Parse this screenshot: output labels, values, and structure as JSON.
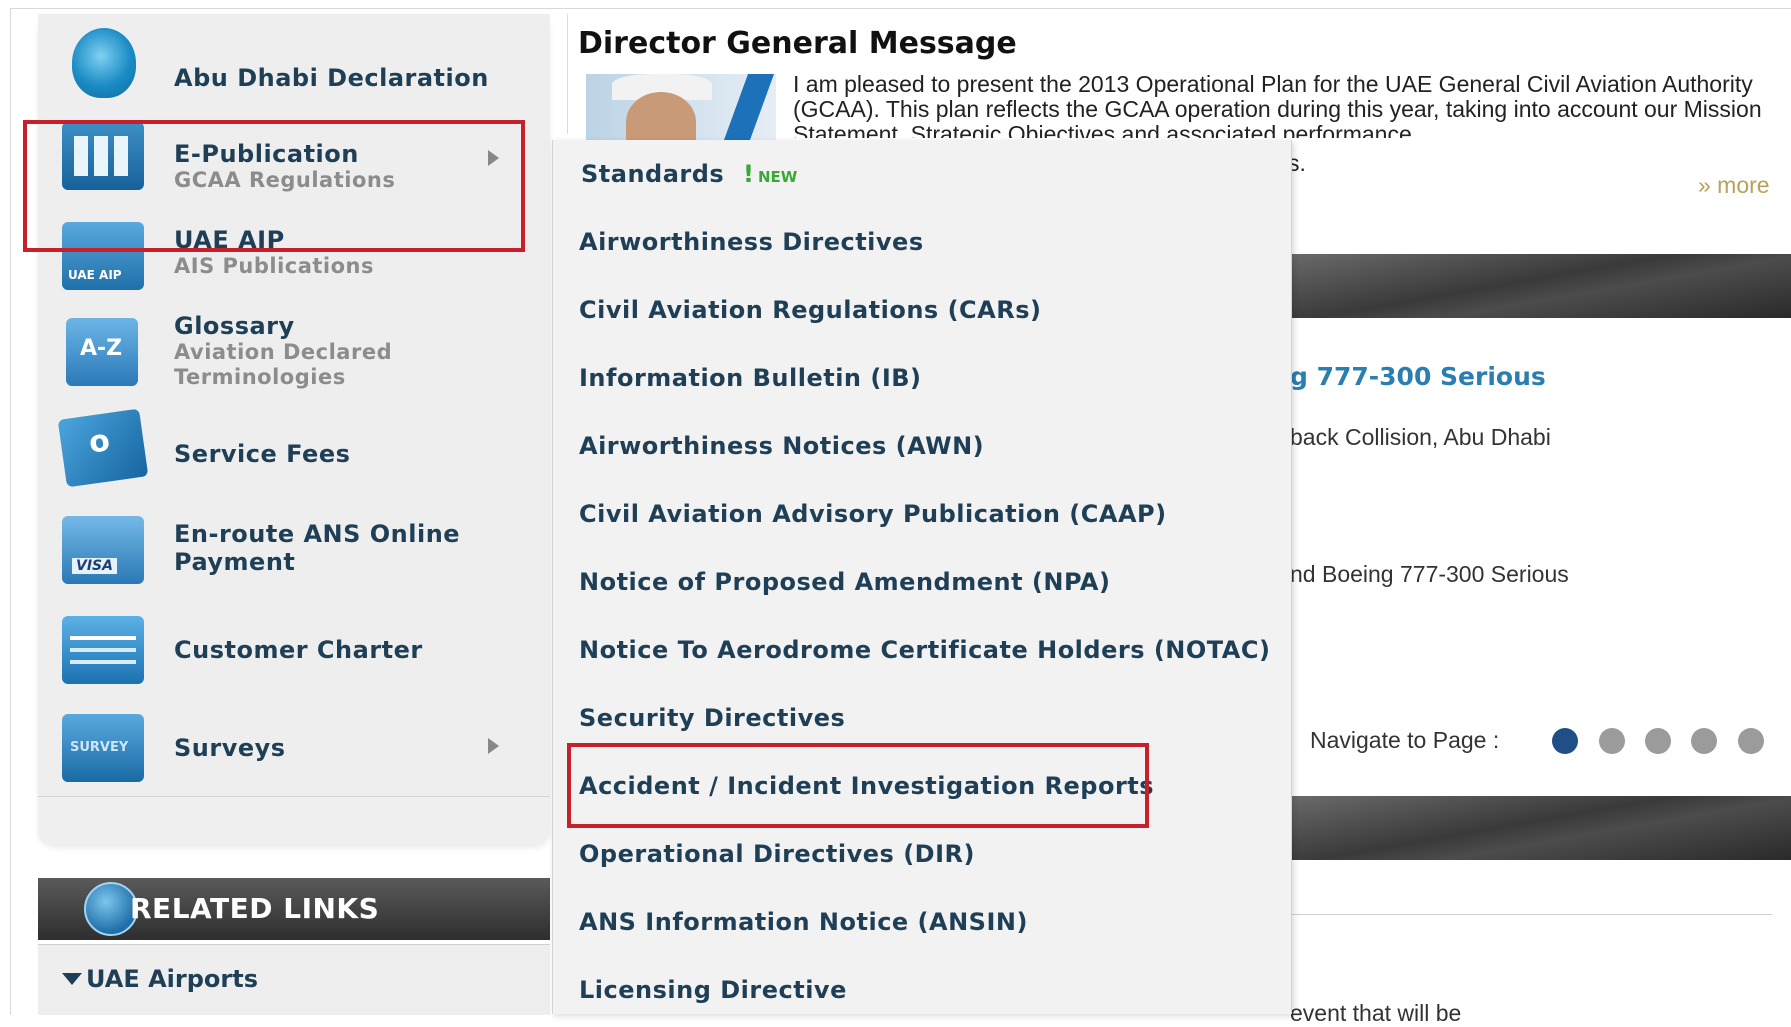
{
  "sidebar": {
    "items": [
      {
        "title": "Abu Dhabi Declaration",
        "icon": "declaration-icon"
      },
      {
        "title": "E-Publication",
        "subtitle": "GCAA Regulations",
        "icon": "publication-icon"
      },
      {
        "title": "UAE AIP",
        "subtitle": "AIS Publications",
        "icon": "aip-icon"
      },
      {
        "title": "Glossary",
        "subtitle_line1": "Aviation Declared",
        "subtitle_line2": "Terminologies",
        "icon": "az-icon"
      },
      {
        "title": "Service Fees",
        "icon": "fees-icon"
      },
      {
        "title_line1": "En-route ANS Online",
        "title_line2": "Payment",
        "icon": "visa-card-icon"
      },
      {
        "title": "Customer Charter",
        "icon": "charter-icon"
      },
      {
        "title": "Surveys",
        "icon": "survey-icon"
      }
    ]
  },
  "related": {
    "title": "RELATED LINKS",
    "airports": "UAE Airports"
  },
  "submenu": {
    "items": [
      "Standards",
      "Airworthiness Directives",
      "Civil Aviation Regulations (CARs)",
      "Information Bulletin (IB)",
      "Airworthiness Notices (AWN)",
      "Civil Aviation Advisory Publication (CAAP)",
      "Notice of Proposed Amendment (NPA)",
      "Notice To Aerodrome Certificate Holders (NOTAC)",
      "Security Directives",
      "Accident / Incident Investigation Reports",
      "Operational Directives (DIR)",
      "ANS Information Notice (ANSIN)",
      "Licensing Directive"
    ],
    "new_badge": "NEW"
  },
  "message": {
    "title": "Director General Message",
    "text": "I am pleased to present the 2013 Operational Plan for the UAE General Civil Aviation Authority (GCAA). This plan reflects the GCAA operation during this year, taking into account our Mission Statement, Strategic Objectives and associated performance",
    "tail": "s.",
    "more": "» more"
  },
  "news": {
    "title_fragment": "g 777-300 Serious",
    "line1": "back Collision, Abu Dhabi",
    "line2": "nd Boeing 777-300 Serious",
    "navigate_label": "Navigate to Page :",
    "pages": 5,
    "active_page": 1,
    "bottom_fragment": "event that will be"
  },
  "colors": {
    "highlight": "#c8202a",
    "link": "#2a7fb0",
    "menu_text": "#1f3f56",
    "active_dot": "#1f4f86"
  }
}
